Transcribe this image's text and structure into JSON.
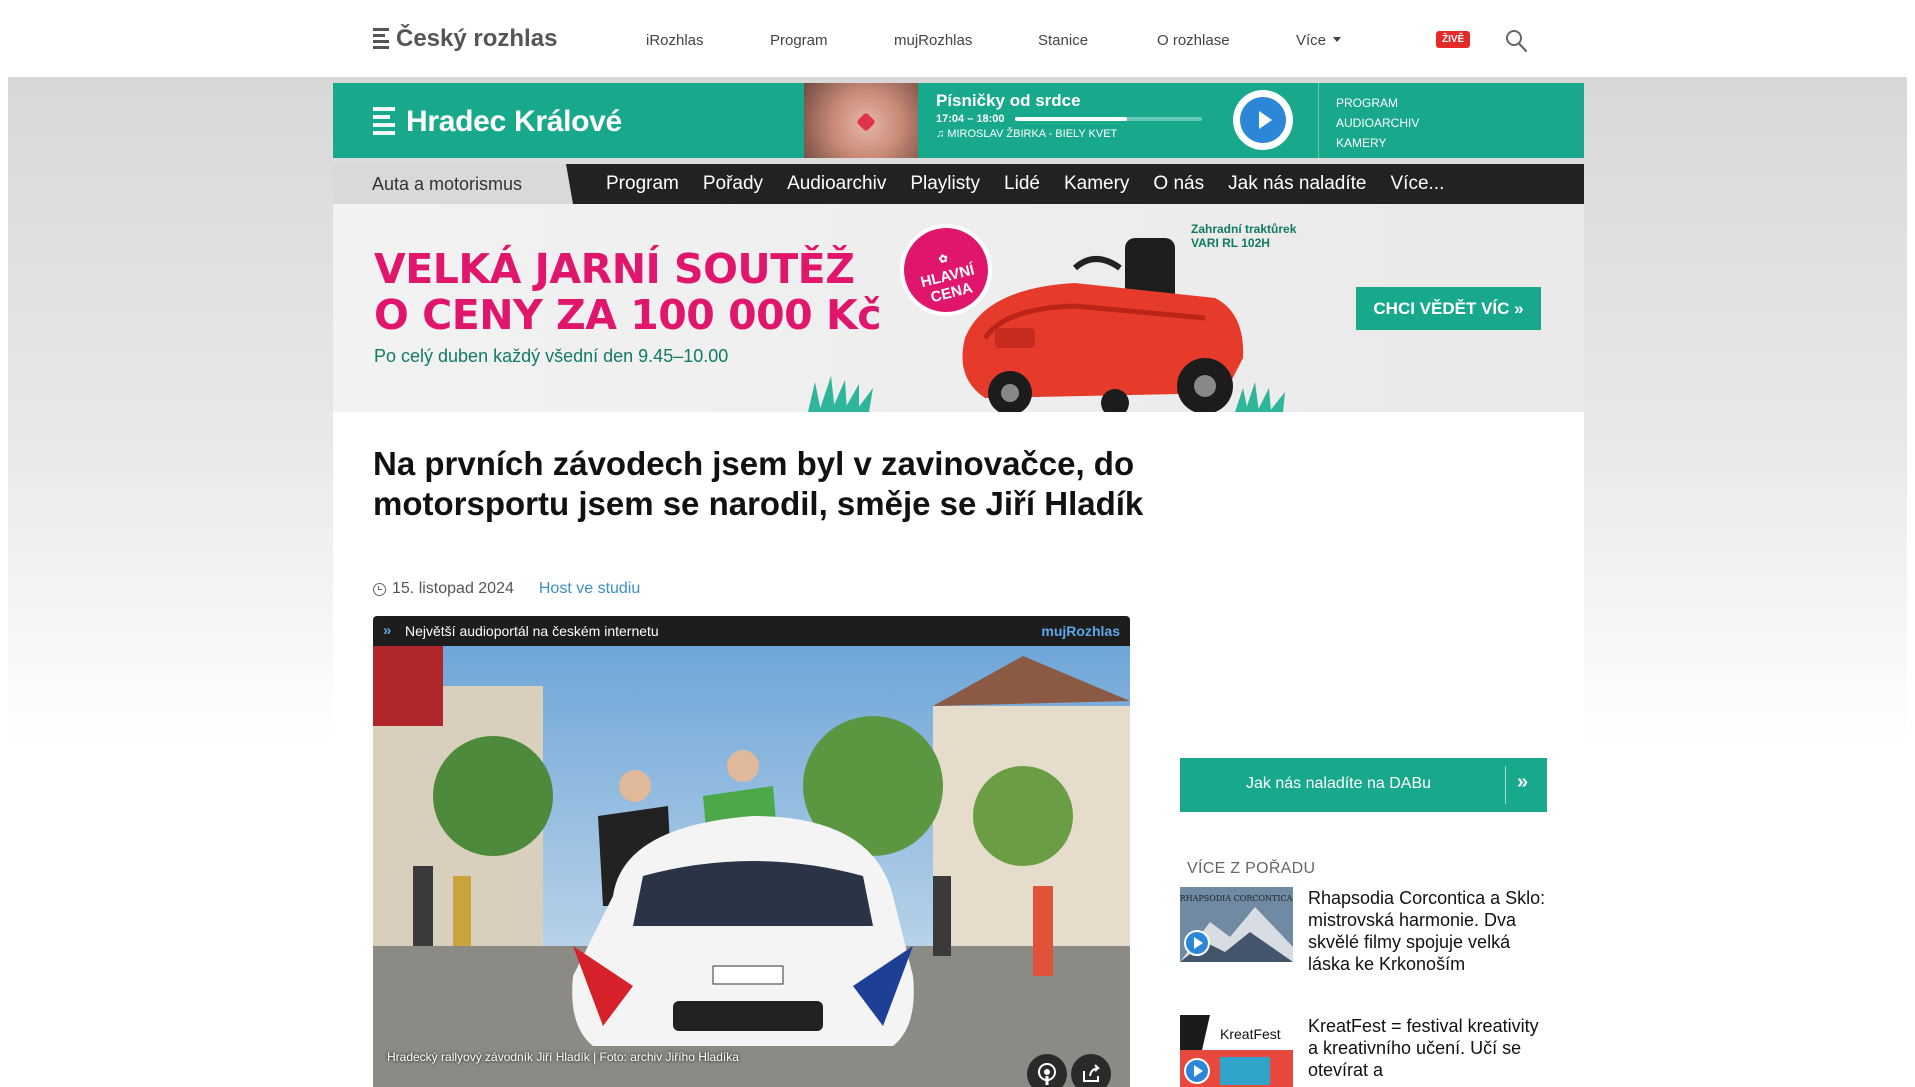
{
  "topnav": {
    "logo": "Český rozhlas",
    "links": [
      "iRozhlas",
      "Program",
      "mujRozhlas",
      "Stanice",
      "O rozhlase",
      "Více"
    ],
    "live_badge": "ŽIVĚ"
  },
  "station": {
    "name": "Hradec Králové",
    "player": {
      "title": "Písničky od srdce",
      "time": "17:04 – 18:00",
      "progress": 0.6,
      "song": "MIROSLAV ŽBIRKA - BIELY KVET"
    },
    "links": [
      "PROGRAM",
      "AUDIOARCHIV",
      "KAMERY"
    ]
  },
  "station_menu": {
    "section": "Auta a motorismus",
    "items": [
      "Program",
      "Pořady",
      "Audioarchiv",
      "Playlisty",
      "Lidé",
      "Kamery",
      "O nás",
      "Jak nás naladíte",
      "Více..."
    ]
  },
  "banner": {
    "headline_1": "VELKÁ JARNÍ SOUTĚŽ",
    "headline_2": "O CENY ZA 100 000 Kč",
    "subline": "Po celý duben každý všední den 9.45–10.00",
    "badge_1": "HLAVNÍ",
    "badge_2": "CENA",
    "prize_1": "Zahradní traktůrek",
    "prize_2": "VARI RL 102H",
    "cta": "CHCI VĚDĚT VÍC »"
  },
  "article": {
    "title": "Na prvních závodech jsem byl v zavinovačce, do motorsportu jsem se narodil, směje se Jiří Hladík",
    "date": "15. listopad 2024",
    "show": "Host ve studiu",
    "media_bar_text": "Největší audioportál na českém internetu",
    "media_bar_brand": "mujRozhlas",
    "caption": "Hradecký rallyový závodník Jiří Hladík | Foto: archiv Jiřího Hladíka"
  },
  "sidebar": {
    "dab_button": "Jak nás naladíte na DABu",
    "more_heading": "Více z pořadu",
    "items": [
      {
        "text": "Rhapsodia Corcontica a Sklo: mistrovská harmonie. Dva skvělé filmy spojuje velká láska ke Krkonoším",
        "thumb_text": "RHAPSODIA CORCONTICA"
      },
      {
        "text": "KreatFest = festival kreativity a kreativního učení. Učí se otevírat a",
        "thumb_text": "KreatFest"
      }
    ]
  },
  "colors": {
    "brand_green": "#18a98c",
    "accent_pink": "#e0166d",
    "live_red": "#e52a2a",
    "play_blue": "#2d87d8",
    "menu_dark": "#222222"
  }
}
